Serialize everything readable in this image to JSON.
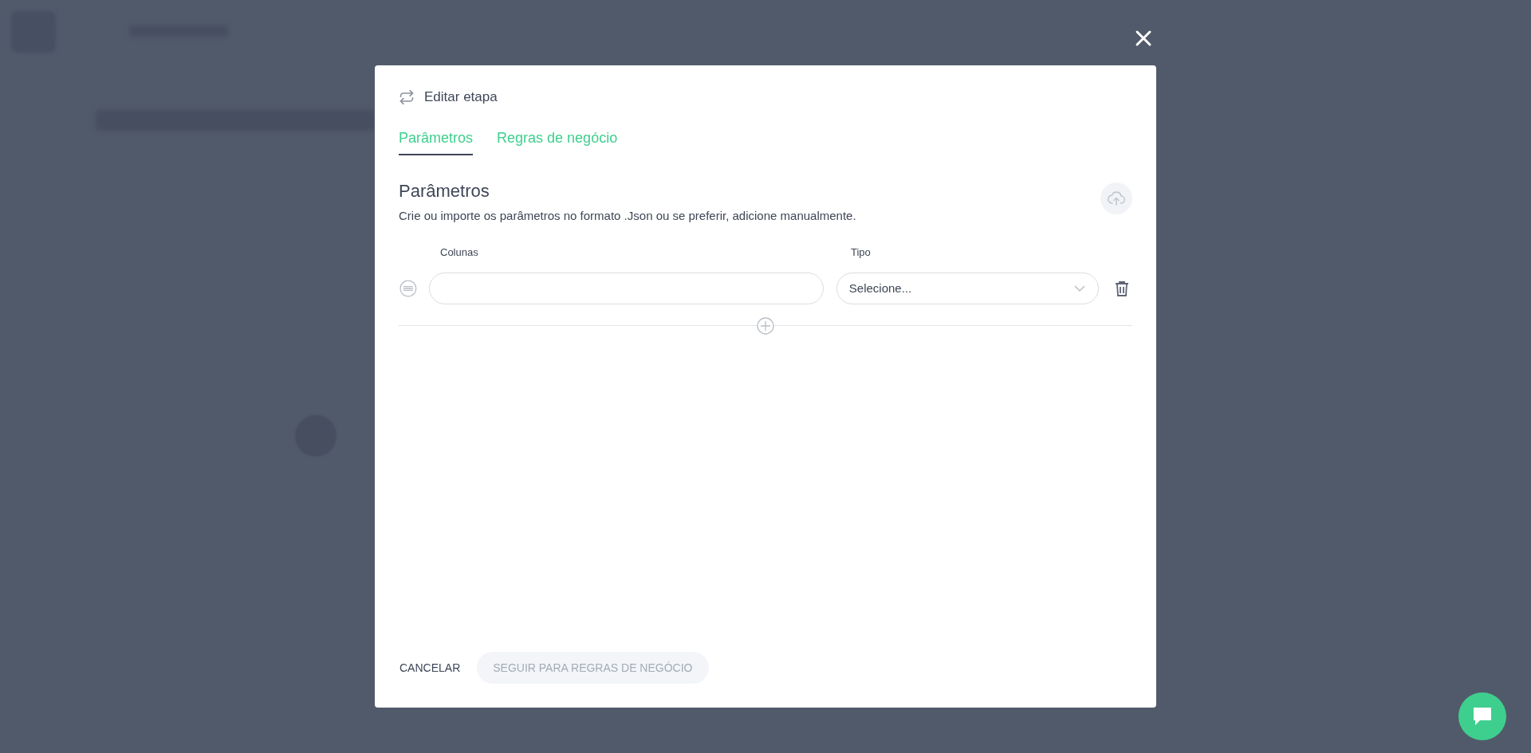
{
  "dialog": {
    "title": "Editar etapa",
    "tabs": [
      {
        "label": "Parâmetros",
        "selected": true
      },
      {
        "label": "Regras de negócio",
        "selected": false
      }
    ],
    "section": {
      "title": "Parâmetros",
      "description": "Crie ou importe os parâmetros no formato .Json ou se preferir, adicione manualmente."
    },
    "columns": [
      "Colunas",
      "Tipo"
    ],
    "rows": [
      {
        "type_placeholder": "Selecione..."
      }
    ],
    "buttons": [
      {
        "label": "CANCELAR",
        "kind": "text",
        "disabled": false
      },
      {
        "label": "SEGUIR PARA REGRAS DE NEGÓCIO",
        "kind": "filled",
        "disabled": true
      }
    ]
  }
}
